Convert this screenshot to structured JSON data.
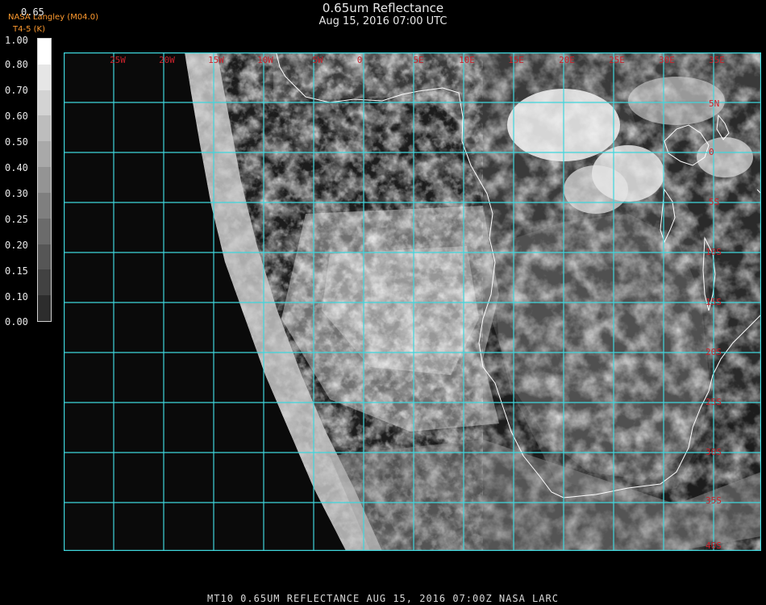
{
  "header": {
    "title": "0.65um Reflectance",
    "subtitle": "Aug 15, 2016 07:00 UTC"
  },
  "credit": "NASA Langley (M04.0)",
  "product_label": "T4-5 (K)",
  "scale": {
    "top_label": "0.65",
    "ticks": [
      "1.00",
      "0.80",
      "0.70",
      "0.60",
      "0.50",
      "0.40",
      "0.30",
      "0.25",
      "0.20",
      "0.15",
      "0.10",
      "0.00"
    ]
  },
  "map": {
    "lon_labels": [
      "25W",
      "20W",
      "15W",
      "10W",
      "5W",
      "0",
      "5E",
      "10E",
      "15E",
      "20E",
      "25E",
      "30E",
      "35E"
    ],
    "lat_labels": [
      "5N",
      "0",
      "5S",
      "10S",
      "15S",
      "20S",
      "25S",
      "30S",
      "35S",
      "40S"
    ],
    "grid_color": "#3fd6dc",
    "coast_color": "#ffffff",
    "label_color": "#c8232c"
  },
  "footer": "MT10  0.65UM REFLECTANCE   AUG 15, 2016 07:00Z   NASA LARC"
}
